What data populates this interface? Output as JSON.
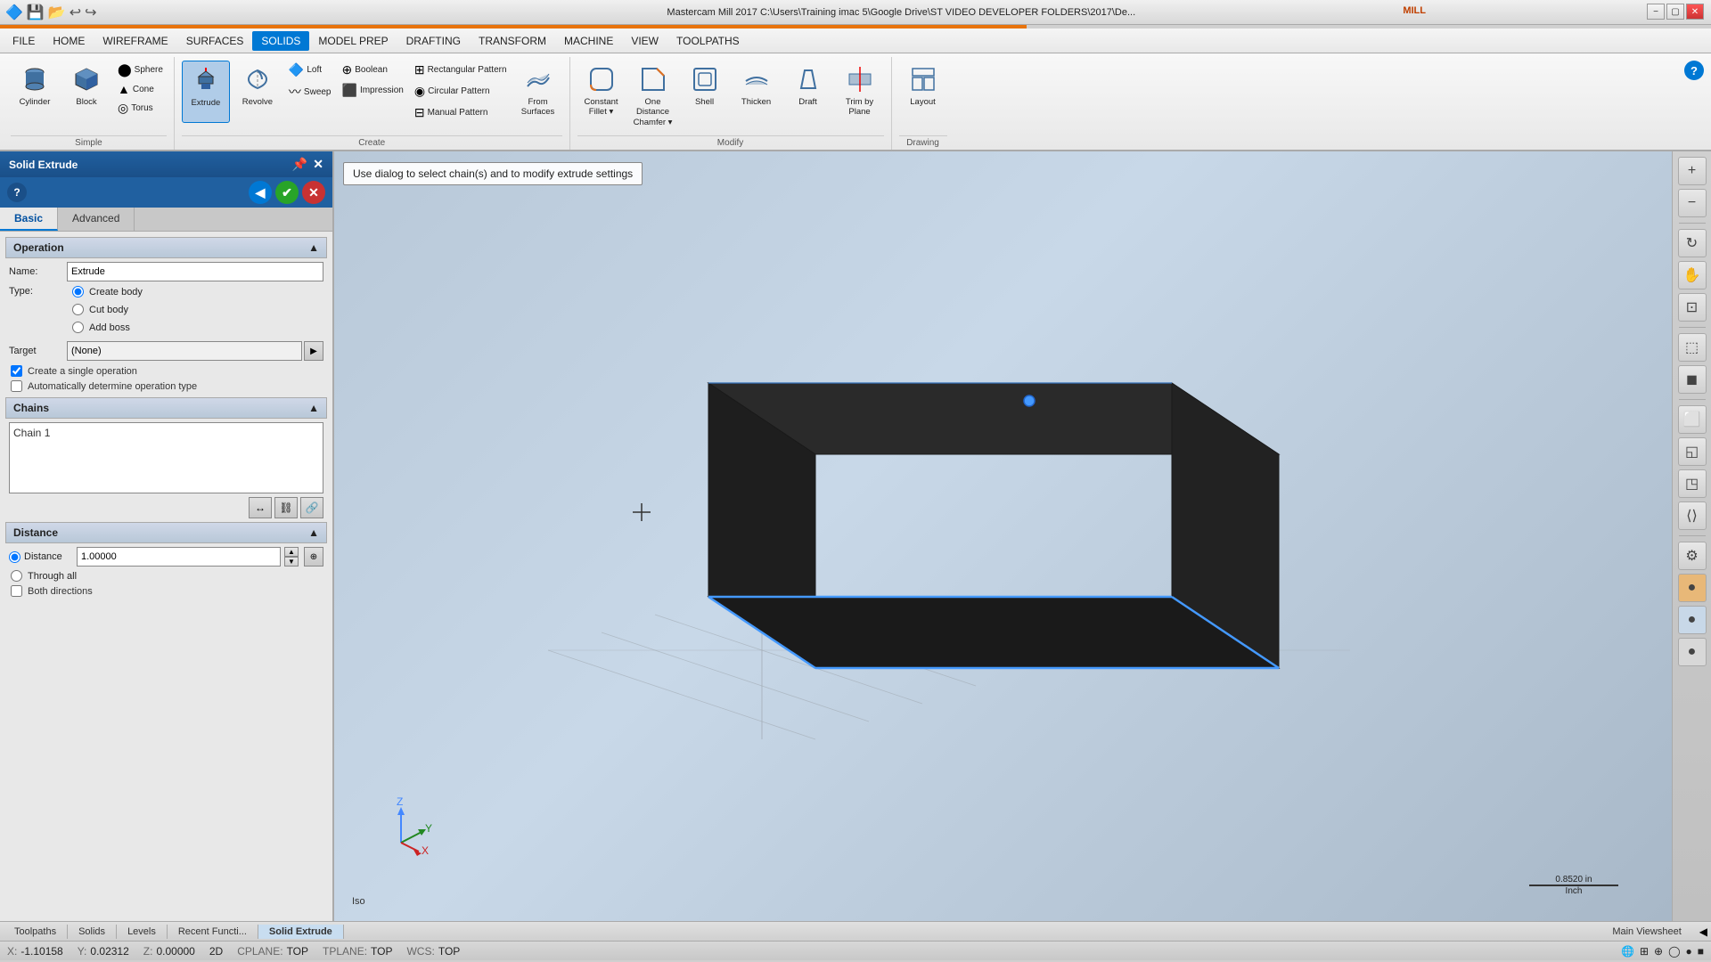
{
  "titlebar": {
    "title": "Mastercam Mill 2017  C:\\Users\\Training imac 5\\Google Drive\\ST VIDEO DEVELOPER FOLDERS\\2017\\De...",
    "app_name": "MILL",
    "min_label": "−",
    "max_label": "▢",
    "close_label": "✕"
  },
  "menu": {
    "items": [
      "FILE",
      "HOME",
      "WIREFRAME",
      "SURFACES",
      "SOLIDS",
      "MODEL PREP",
      "DRAFTING",
      "TRANSFORM",
      "MACHINE",
      "VIEW",
      "TOOLPATHS"
    ]
  },
  "ribbon": {
    "simple_group": {
      "label": "Simple",
      "items": [
        "Cylinder",
        "Block",
        "Sphere",
        "Cone",
        "Torus"
      ]
    },
    "extrude_btn": "Extrude",
    "revolve_btn": "Revolve",
    "loft_btn": "Loft",
    "sweep_btn": "Sweep",
    "boolean_btn": "Boolean",
    "impression_btn": "Impression",
    "create_label": "Create",
    "pattern_items": [
      "Rectangular Pattern",
      "Circular Pattern",
      "Manual Pattern"
    ],
    "from_surfaces_btn": "From Surfaces",
    "modify_label": "Modify",
    "constant_fillet_btn": "Constant Fillet",
    "one_distance_chamfer_btn": "One Distance Chamfer",
    "shell_btn": "Shell",
    "thicken_btn": "Thicken",
    "draft_btn": "Draft",
    "trim_by_plane_btn": "Trim by Plane",
    "layout_btn": "Layout",
    "drawing_label": "Drawing"
  },
  "panel": {
    "title": "Solid Extrude",
    "pin_icon": "📌",
    "close_icon": "✕",
    "help_icon": "?",
    "back_icon": "◀",
    "ok_icon": "✔",
    "cancel_icon": "✕",
    "tabs": [
      "Basic",
      "Advanced"
    ],
    "active_tab": "Basic",
    "operation_section": "Operation",
    "name_label": "Name:",
    "name_value": "Extrude",
    "type_label": "Type:",
    "type_options": [
      "Create body",
      "Cut body",
      "Add boss"
    ],
    "type_selected": "Create body",
    "target_label": "Target",
    "target_value": "(None)",
    "target_btn": "▶",
    "create_single_op": "Create a single operation",
    "create_single_checked": true,
    "auto_determine": "Automatically determine operation type",
    "auto_determine_checked": false,
    "chains_section": "Chains",
    "chain_item": "Chain 1",
    "chain_btn1": "↔",
    "chain_btn2": "⛓",
    "chain_btn3": "🔗",
    "distance_section": "Distance",
    "distance_radio": "Distance",
    "distance_value": "1.00000",
    "through_all": "Through all",
    "both_directions": "Both directions",
    "distance_radio_checked": true,
    "through_all_checked": false,
    "both_dirs_checked": false
  },
  "viewport": {
    "info_message": "Use dialog to select chain(s) and to modify extrude settings",
    "iso_label": "Iso",
    "scale_value": "0.8520 in",
    "scale_unit": "Inch"
  },
  "bottom_tabs": {
    "items": [
      "Toolpaths",
      "Solids",
      "Levels",
      "Recent Functi...",
      "Solid Extrude"
    ],
    "active": "Solid Extrude",
    "right_item": "Main Viewsheet"
  },
  "statusbar": {
    "x_label": "X:",
    "x_value": "-1.10158",
    "y_label": "Y:",
    "y_value": "0.02312",
    "z_label": "Z:",
    "z_value": "0.00000",
    "mode": "2D",
    "cplane_label": "CPLANE:",
    "cplane_value": "TOP",
    "tplane_label": "TPLANE:",
    "tplane_value": "TOP",
    "wcs_label": "WCS:",
    "wcs_value": "TOP"
  }
}
